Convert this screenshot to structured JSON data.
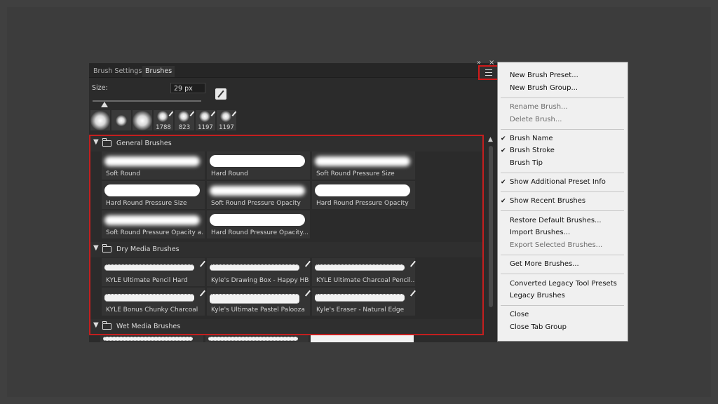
{
  "tabs": {
    "brush_settings": "Brush Settings",
    "brushes": "Brushes"
  },
  "collapse_glyph": "»",
  "close_glyph": "×",
  "size": {
    "label": "Size:",
    "value": "29 px",
    "slider_fraction": 0.11
  },
  "recent_brushes": [
    {
      "count": ""
    },
    {
      "count": ""
    },
    {
      "count": ""
    },
    {
      "count": "1788"
    },
    {
      "count": "823"
    },
    {
      "count": "1197"
    },
    {
      "count": "1197"
    }
  ],
  "groups": {
    "general": {
      "title": "General Brushes",
      "presets": [
        "Soft Round",
        "Hard Round",
        "Soft Round Pressure Size",
        "Hard Round Pressure Size",
        "Soft Round Pressure Opacity",
        "Hard Round Pressure Opacity",
        "Soft Round Pressure Opacity a...",
        "Hard Round Pressure Opacity..."
      ]
    },
    "dry": {
      "title": "Dry Media Brushes",
      "presets": [
        "KYLE Ultimate Pencil Hard",
        "Kyle's Drawing Box - Happy HB",
        "KYLE Ultimate Charcoal Pencil...",
        "KYLE Bonus Chunky Charcoal",
        "Kyle's Ultimate Pastel Palooza",
        "Kyle's Eraser - Natural Edge"
      ]
    },
    "wet": {
      "title": "Wet Media Brushes"
    }
  },
  "menu": {
    "new_brush_preset": "New Brush Preset...",
    "new_brush_group": "New Brush Group...",
    "rename_brush": "Rename Brush...",
    "delete_brush": "Delete Brush...",
    "brush_name": "Brush Name",
    "brush_stroke": "Brush Stroke",
    "brush_tip": "Brush Tip",
    "show_additional_info": "Show Additional Preset Info",
    "show_recent": "Show Recent Brushes",
    "restore_default": "Restore Default Brushes...",
    "import_brushes": "Import Brushes...",
    "export_selected": "Export Selected Brushes...",
    "get_more": "Get More Brushes...",
    "converted_legacy": "Converted Legacy Tool Presets",
    "legacy_brushes": "Legacy Brushes",
    "close": "Close",
    "close_tab_group": "Close Tab Group",
    "check_glyph": "✔"
  }
}
